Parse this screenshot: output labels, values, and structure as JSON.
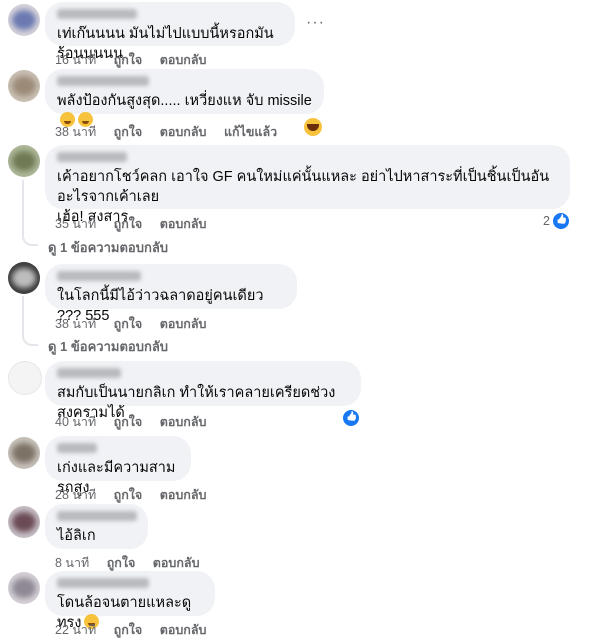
{
  "comments": [
    {
      "text": "เท่เก๊นนนน มันไม่ไปแบบนี้หรอกมันร้อนนนนน",
      "time": "16 นาที",
      "like": "ถูกใจ",
      "reply": "ตอบกลับ",
      "edited": ""
    },
    {
      "text": "พลังป้องกันสูงสุด..... เหวี่ยงแห จับ missile",
      "time": "38 นาที",
      "like": "ถูกใจ",
      "reply": "ตอบกลับ",
      "edited": "แก้ไขแล้ว"
    },
    {
      "text": "เค้าอยากโชว์คลก เอาใจ GF คนใหม่แค่นั้นแหละ อย่าไปหาสาระที่เป็นชิ้นเป็นอันอะไรจากเค้าเลย\nเฮ้อ! สงสาร",
      "time": "35 นาที",
      "like": "ถูกใจ",
      "reply": "ตอบกลับ",
      "reactions": "2",
      "replies": "ดู 1 ข้อความตอบกลับ"
    },
    {
      "text": "ในโลกนี้มีไอ้ว่าวฉลาดอยู่คนเดียว ??? 555",
      "time": "38 นาที",
      "like": "ถูกใจ",
      "reply": "ตอบกลับ",
      "replies": "ดู 1 ข้อความตอบกลับ"
    },
    {
      "text": "สมกับเป็นนายกลิเก ทำให้เราคลายเครียดช่วงสงครามได้",
      "time": "40 นาที",
      "like": "ถูกใจ",
      "reply": "ตอบกลับ"
    },
    {
      "text": "เก่งและมีความสามรถสูง",
      "time": "28 นาที",
      "like": "ถูกใจ",
      "reply": "ตอบกลับ"
    },
    {
      "text": "ไอ้ลิเก",
      "time": "8 นาที",
      "like": "ถูกใจ",
      "reply": "ตอบกลับ"
    },
    {
      "text": "โดนล้อจนตายแหละดูทรง",
      "time": "22 นาที",
      "like": "ถูกใจ",
      "reply": "ตอบกลับ"
    }
  ],
  "more_options": "···",
  "icons": {
    "like": "like-icon",
    "emoji": "smile-emoji-icon",
    "laugh": "laugh-reaction-icon"
  },
  "colors": {
    "bubble": "#f0f2f5",
    "meta": "#65676b",
    "like_blue": "#1877f2"
  }
}
